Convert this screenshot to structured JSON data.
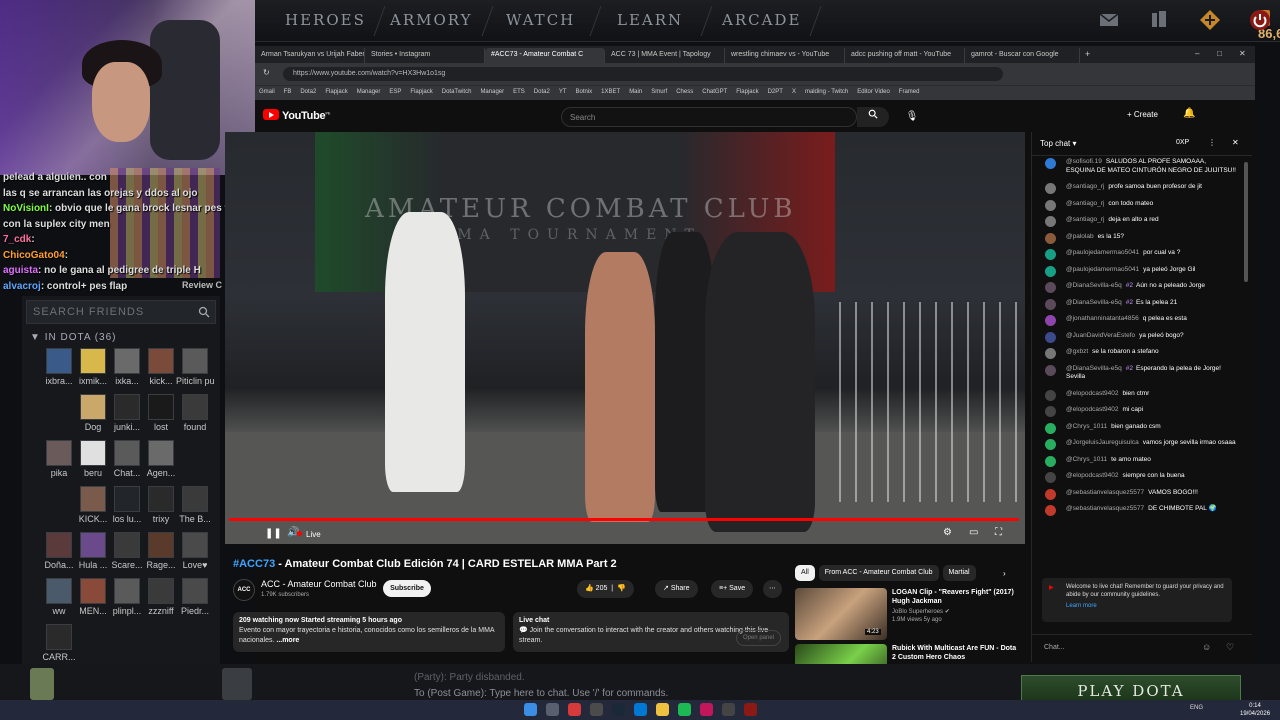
{
  "dota": {
    "nav": [
      "HEROES",
      "ARMORY",
      "WATCH",
      "LEARN",
      "ARCADE"
    ],
    "gold": "86,695",
    "play_button": "PLAY DOTA",
    "party_text": "(Party): Party disbanded.",
    "post_game": "To (Post Game): Type here to chat. Use '/' for commands."
  },
  "stream_chat": [
    {
      "user": "",
      "text": "pelead a alguien.. con",
      "color": "#ffffff"
    },
    {
      "user": "",
      "text": "las q se arrancan las orejas y ddos al ojo",
      "color": "#ffffff"
    },
    {
      "user": "NoVisionI",
      "text": ": obvio que le gana brock lesnar pes flap,",
      "color": "#7fff3f"
    },
    {
      "user": "",
      "text": "con la suplex city men",
      "color": "#ffffff"
    },
    {
      "user": "7_cdk",
      "text": ":",
      "color": "#ff6fa0"
    },
    {
      "user": "ChicoGato04",
      "text": ":",
      "color": "#ff9f30"
    },
    {
      "user": "aguista",
      "text": ": no le gana al pedigree de triple H",
      "color": "#e070ff"
    },
    {
      "user": "alvacroj",
      "text": ": control+ pes flap",
      "color": "#5fa8ff"
    }
  ],
  "friends": {
    "search_placeholder": "SEARCH FRIENDS",
    "header": "IN DOTA (36)",
    "list": [
      "ixbra...",
      "ixmik...",
      "ixka...",
      "kick...",
      "Piticlin pugn...",
      "",
      "Dog",
      "junki...",
      "lost",
      "found",
      "pika",
      "beru",
      "Chat...",
      "Agen...",
      "",
      "",
      "KICK...",
      "los lu...",
      "trixy",
      "The B...",
      "Doña...",
      "Hula ...",
      "Scare...",
      "Rage...",
      "Love♥",
      "ww",
      "MEN...",
      "plinpl...",
      "zzzniff",
      "Piedr...",
      "CARR..."
    ],
    "review_label": "Review C"
  },
  "browser": {
    "tabs": [
      "Arman Tsarukyan vs Urijah Faber",
      "Stories • Instagram",
      "#ACC73 - Amateur Combat C",
      "ACC 73 | MMA Event | Tapology",
      "wrestling chimaev vs - YouTube",
      "adcc pushing off matt - YouTube",
      "gamrot - Buscar con Google"
    ],
    "url": "https://www.youtube.com/watch?v=HX3Hw1o1sg",
    "bookmarks": [
      "Gmail",
      "FB",
      "Dota2",
      "Flapjack",
      "Manager",
      "ESP",
      "Flapjack",
      "DotaTwitch",
      "Manager",
      "ETS",
      "Dota2",
      "YT",
      "Botnix",
      "1XBET",
      "Main",
      "Smurf",
      "Chess",
      "ChatGPT",
      "Flapjack",
      "D2PT",
      "X",
      "malding - Twitch",
      "Editor Video",
      "Framed"
    ]
  },
  "youtube": {
    "logo": "YouTube",
    "region": "PE",
    "search_placeholder": "Search",
    "create_label": "Create",
    "live_label": "Live",
    "banner_text": "AMATEUR COMBAT CLUB",
    "banner_sub": "MMA TOURNAMENT",
    "title_hash": "#ACC73",
    "title_rest": " - Amateur Combat Club Edición 74 | CARD ESTELAR MMA Part 2",
    "channel": "ACC - Amateur Combat Club",
    "channel_icon": "ACC",
    "subscribers": "1.79K subscribers",
    "subscribe": "Subscribe",
    "likes": "205",
    "share": "Share",
    "save": "Save",
    "desc_stats": "209 watching now  Started streaming 5 hours ago",
    "desc_text": "Evento con mayor trayectoria e historia, conocidos como los semilleros de la MMA nacionales.",
    "desc_more": "...more",
    "livechat_title": "Live chat",
    "livechat_text": "Join the conversation to interact with the creator and others watching this live stream.",
    "open_panel": "Open panel"
  },
  "recommendations": {
    "chips": [
      "All",
      "From ACC - Amateur Combat Club",
      "Martial"
    ],
    "items": [
      {
        "title": "LOGAN Clip - \"Reavers Fight\" (2017) Hugh Jackman",
        "channel": "JoBlo Superheroes ✔",
        "meta": "1.9M views  5y ago",
        "duration": "4:23"
      },
      {
        "title": "Rubick With Multicast Are FUN - Dota 2 Custom Hero Chaos",
        "channel": "",
        "meta": "",
        "duration": ""
      }
    ]
  },
  "live_chat": {
    "header": "Top chat",
    "xp": "0XP",
    "input_placeholder": "Chat...",
    "welcome": "Welcome to live chat! Remember to guard your privacy and abide by our community guidelines.",
    "learn_more": "Learn more",
    "messages": [
      {
        "author": "@sofisofi.19",
        "text": "SALUDOS AL PROFE SAMOAAA, ESQUINA DE MATEO CINTURÓN NEGRO DE JUIJITSU!!",
        "color": "#2e7bd6",
        "badge": ""
      },
      {
        "author": "@santiago_rj",
        "text": "profe samoa buen profesor de jit",
        "color": "#777",
        "badge": ""
      },
      {
        "author": "@santiago_rj",
        "text": "con todo mateo",
        "color": "#777",
        "badge": ""
      },
      {
        "author": "@santiago_rj",
        "text": "deja en alto a red",
        "color": "#777",
        "badge": ""
      },
      {
        "author": "@palolab",
        "text": "es la 15?",
        "color": "#8a5a3a",
        "badge": ""
      },
      {
        "author": "@paulojedamermao5041",
        "text": "por cual va ?",
        "color": "#16a085",
        "badge": ""
      },
      {
        "author": "@paulojedamermao5041",
        "text": "ya peleó Jorge Gil",
        "color": "#16a085",
        "badge": ""
      },
      {
        "author": "@DianaSevilla-e5q",
        "text": "Aún no a peleado Jorge",
        "color": "#5a4a5a",
        "badge": "#2"
      },
      {
        "author": "@DianaSevilla-e5q",
        "text": "Es la pelea 21",
        "color": "#5a4a5a",
        "badge": "#2"
      },
      {
        "author": "@jonathanninatanta4856",
        "text": "q pelea es esta",
        "color": "#8e44ad",
        "badge": ""
      },
      {
        "author": "@JuanDavidVeraEstefo",
        "text": "ya peleó bogo?",
        "color": "#3b4a8a",
        "badge": ""
      },
      {
        "author": "@gxbzt",
        "text": "se la robaron a stefano",
        "color": "#777",
        "badge": ""
      },
      {
        "author": "@DianaSevilla-e5q",
        "text": "Esperando la pelea de Jorge! Sevilla",
        "color": "#5a4a5a",
        "badge": "#2"
      },
      {
        "author": "@elopodcast9402",
        "text": "bien ctmr",
        "color": "#444",
        "badge": ""
      },
      {
        "author": "@elopodcast9402",
        "text": "mi capi",
        "color": "#444",
        "badge": ""
      },
      {
        "author": "@Chrys_1011",
        "text": "bien ganado csm",
        "color": "#27ae60",
        "badge": ""
      },
      {
        "author": "@JorgeluisJaureguisulca",
        "text": "vamos jorge sevilla irmao osaaa",
        "color": "#27ae60",
        "badge": ""
      },
      {
        "author": "@Chrys_1011",
        "text": "te amo mateo",
        "color": "#27ae60",
        "badge": ""
      },
      {
        "author": "@elopodcast9402",
        "text": "siempre con la buena",
        "color": "#444",
        "badge": ""
      },
      {
        "author": "@sebastianvelasquez5577",
        "text": "VAMOS BOGO!!!",
        "color": "#c0392b",
        "badge": ""
      },
      {
        "author": "@sebastianvelasquez5577",
        "text": "DE CHIMBOTE PAL 🌍",
        "color": "#c0392b",
        "badge": ""
      }
    ]
  },
  "taskbar": {
    "lang": "ENG",
    "time": "0:14",
    "date": "19/04/2026"
  }
}
